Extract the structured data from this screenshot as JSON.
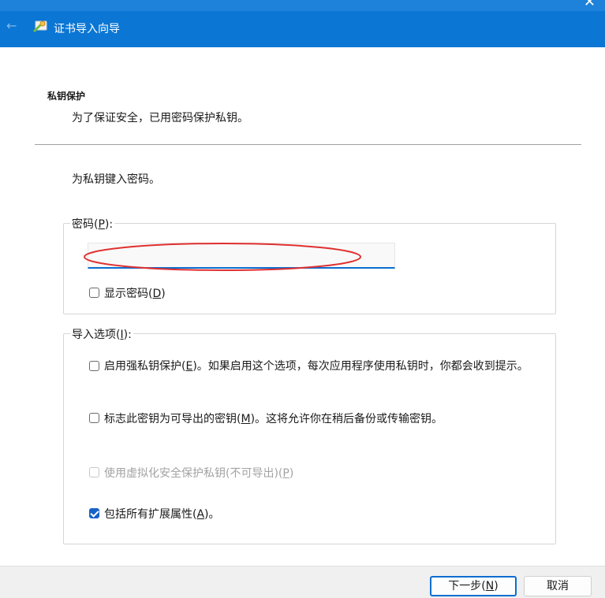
{
  "window": {
    "title": "证书导入向导",
    "close_glyph": "✕",
    "back_glyph": "←"
  },
  "header": {
    "section_title": "私钥保护",
    "section_subtitle": "为了保证安全，已用密码保护私钥。"
  },
  "instruction": "为私钥键入密码。",
  "password_group": {
    "legend_prefix": "密码(",
    "legend_key": "P",
    "legend_suffix": "):",
    "password_value": "",
    "show_password": {
      "prefix": "显示密码(",
      "key": "D",
      "suffix": ")",
      "checked": false
    }
  },
  "import_options": {
    "legend_prefix": "导入选项(",
    "legend_key": "I",
    "legend_suffix": "):",
    "options": [
      {
        "prefix": "启用强私钥保护(",
        "key": "E",
        "suffix": ")。如果启用这个选项，每次应用程序使用私钥时，你都会收到提示。",
        "checked": false,
        "enabled": true
      },
      {
        "prefix": "标志此密钥为可导出的密钥(",
        "key": "M",
        "suffix": ")。这将允许你在稍后备份或传输密钥。",
        "checked": false,
        "enabled": true
      },
      {
        "prefix": "使用虚拟化安全保护私钥(不可导出)(",
        "key": "P",
        "suffix": ")",
        "checked": false,
        "enabled": false
      },
      {
        "prefix": "包括所有扩展属性(",
        "key": "A",
        "suffix": ")。",
        "checked": true,
        "enabled": true
      }
    ]
  },
  "footer": {
    "next_prefix": "下一步(",
    "next_key": "N",
    "next_suffix": ")",
    "cancel_label": "取消"
  },
  "colors": {
    "titlebar": "#0b76d4",
    "accent": "#0b6ed0",
    "annotation": "#e03030"
  }
}
